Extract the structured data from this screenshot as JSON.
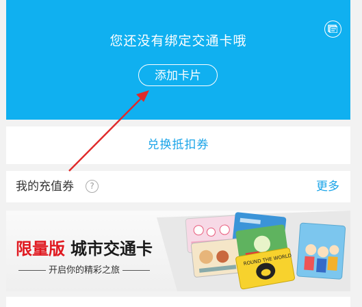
{
  "card_area": {
    "title": "您还没有绑定交通卡哦",
    "add_button": "添加卡片",
    "icon": "card-list-icon"
  },
  "redeem": {
    "label": "兑换抵扣券"
  },
  "vouchers": {
    "title": "我的充值券",
    "help_glyph": "?",
    "more_label": "更多"
  },
  "banner": {
    "highlight": "限量版",
    "main": "城市交通卡",
    "subtitle": "开启你的精彩之旅",
    "card_images": [
      "hello-kitty-card",
      "cartoon-card",
      "round-the-world-card",
      "people-card"
    ]
  },
  "colors": {
    "primary_blue": "#10b0f0",
    "link_blue": "#1aa4e8",
    "accent_red": "#e01920"
  }
}
